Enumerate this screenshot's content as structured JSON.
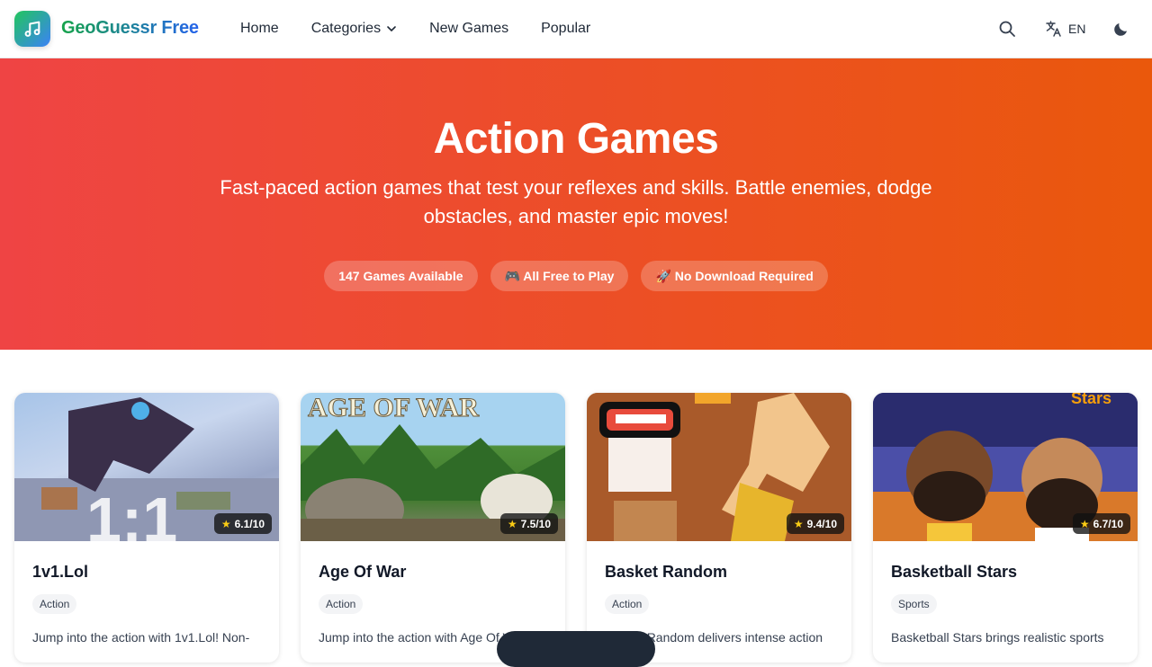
{
  "header": {
    "brand": "GeoGuessr Free",
    "nav": [
      {
        "label": "Home"
      },
      {
        "label": "Categories"
      },
      {
        "label": "New Games"
      },
      {
        "label": "Popular"
      }
    ],
    "language": "EN"
  },
  "hero": {
    "title": "Action Games",
    "subtitle": "Fast-paced action games that test your reflexes and skills. Battle enemies, dodge obstacles, and master epic moves!",
    "pills": [
      {
        "label": "147 Games Available"
      },
      {
        "label": "🎮 All Free to Play"
      },
      {
        "label": "🚀 No Download Required"
      }
    ]
  },
  "games": [
    {
      "title": "1v1.Lol",
      "rating": "6.1/10",
      "tag": "Action",
      "desc": "Jump into the action with 1v1.Lol! Non-"
    },
    {
      "title": "Age Of War",
      "rating": "7.5/10",
      "tag": "Action",
      "desc": "Jump into the action with Age Of War"
    },
    {
      "title": "Basket Random",
      "rating": "9.4/10",
      "tag": "Action",
      "desc": "Basket Random delivers intense action"
    },
    {
      "title": "Basketball Stars",
      "rating": "6.7/10",
      "tag": "Sports",
      "desc": "Basketball Stars brings realistic sports"
    }
  ],
  "colors": {
    "hero_start": "#ef4444",
    "hero_end": "#ea580c",
    "brand_start": "#16a34a",
    "brand_end": "#2563eb"
  },
  "icons": [
    "music-note-icon",
    "chevron-down-icon",
    "search-icon",
    "translate-icon",
    "moon-icon",
    "star-icon"
  ]
}
